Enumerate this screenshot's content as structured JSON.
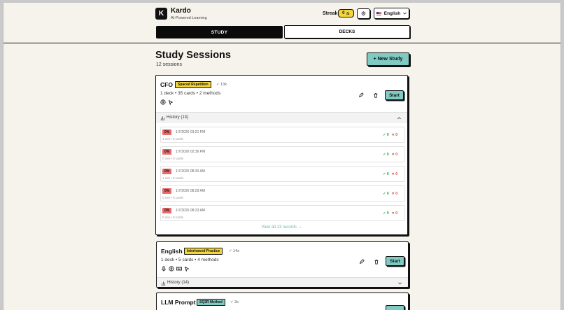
{
  "header": {
    "logo_letter": "K",
    "brand": "Kardo",
    "tagline": "AI-Powered Learning",
    "streak_label": "Streak",
    "streak_value": "0",
    "language": "English"
  },
  "tabs": {
    "study": "STUDY",
    "decks": "DECKS"
  },
  "page": {
    "title": "Study Sessions",
    "count": "12 sessions",
    "new_button": "+ New Study"
  },
  "sessions": [
    {
      "title": "CFO",
      "method": "Spaced Repetition",
      "count": "13x",
      "meta": "1 deck • 35 cards • 2 methods",
      "start": "Start",
      "history": "History (13)",
      "records": [
        {
          "pct": "0%",
          "time": "1/7/2026 03:21 PM",
          "sub": "4 min • 0 cards",
          "ok": "0",
          "bad": "0"
        },
        {
          "pct": "0%",
          "time": "1/7/2026 02:36 PM",
          "sub": "0 min • 0 cards",
          "ok": "0",
          "bad": "0"
        },
        {
          "pct": "0%",
          "time": "1/7/2026 08:30 AM",
          "sub": "1 min • 0 cards",
          "ok": "0",
          "bad": "0"
        },
        {
          "pct": "0%",
          "time": "1/7/2026 08:29 AM",
          "sub": "0 min • 0 cards",
          "ok": "0",
          "bad": "0"
        },
        {
          "pct": "0%",
          "time": "1/7/2026 08:23 AM",
          "sub": "0 min • 0 cards",
          "ok": "0",
          "bad": "0"
        }
      ],
      "view_all": "View all 13 records →"
    },
    {
      "title": "English",
      "method": "Interleaved Practice",
      "count": "14x",
      "meta": "1 deck • 5 cards • 4 methods",
      "start": "Start",
      "history": "History (14)"
    },
    {
      "title": "LLM Prompt",
      "method": "SQ3R Method",
      "count": "3x"
    }
  ]
}
